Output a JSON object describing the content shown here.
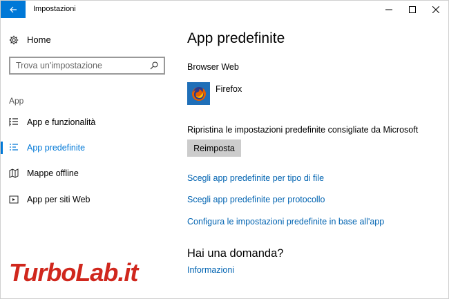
{
  "window": {
    "title": "Impostazioni"
  },
  "sidebar": {
    "home_label": "Home",
    "search_placeholder": "Trova un'impostazione",
    "section_title": "App",
    "items": [
      {
        "label": "App e funzionalità",
        "icon": "list-icon",
        "active": false
      },
      {
        "label": "App predefinite",
        "icon": "defaults-list-icon",
        "active": true
      },
      {
        "label": "Mappe offline",
        "icon": "map-icon",
        "active": false
      },
      {
        "label": "App per siti Web",
        "icon": "website-app-icon",
        "active": false
      }
    ]
  },
  "main": {
    "title": "App predefinite",
    "browser_heading": "Browser Web",
    "browser_name": "Firefox",
    "reset_description": "Ripristina le impostazioni predefinite consigliate da Microsoft",
    "reset_button": "Reimposta",
    "links": [
      "Scegli app predefinite per tipo di file",
      "Scegli app predefinite per protocollo",
      "Configura le impostazioni predefinite in base all'app"
    ],
    "question_title": "Hai una domanda?",
    "info_link": "Informazioni"
  },
  "watermark": {
    "text": "TurboLab.it"
  },
  "colors": {
    "accent": "#0078d7",
    "link": "#0063b1",
    "button_bg": "#cccccc",
    "watermark_red": "#d0271d"
  }
}
